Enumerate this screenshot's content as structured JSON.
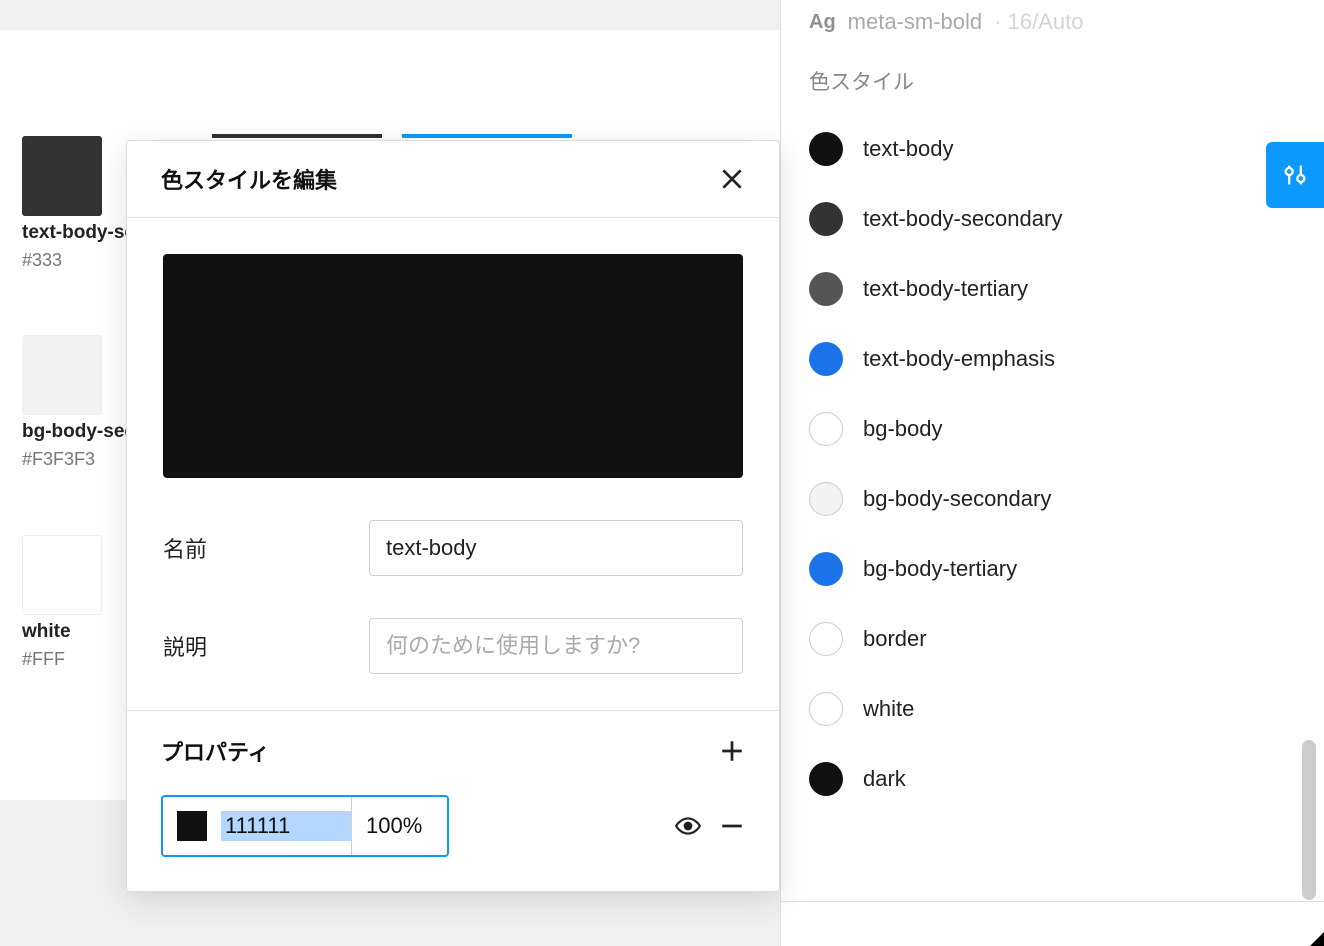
{
  "canvas": {
    "swatches": [
      {
        "label": "text-body-sec",
        "hex": "#333"
      },
      {
        "label": "bg-body-seco",
        "hex": "#F3F3F3"
      },
      {
        "label": "white",
        "hex": "#FFF"
      }
    ]
  },
  "modal": {
    "title": "色スタイルを編集",
    "name_label": "名前",
    "name_value": "text-body",
    "desc_label": "説明",
    "desc_placeholder": "何のために使用しますか?",
    "props_title": "プロパティ",
    "hex_value": "111111",
    "opacity_value": "100%",
    "preview_color": "#111111"
  },
  "right_panel": {
    "text_style": {
      "ag": "Ag",
      "name": "meta-sm-bold",
      "meta": "· 16/Auto"
    },
    "section_title": "色スタイル",
    "styles": [
      {
        "name": "text-body",
        "color": "#111111",
        "outlined": false
      },
      {
        "name": "text-body-secondary",
        "color": "#333333",
        "outlined": false
      },
      {
        "name": "text-body-tertiary",
        "color": "#555555",
        "outlined": false
      },
      {
        "name": "text-body-emphasis",
        "color": "#1a73e8",
        "outlined": false
      },
      {
        "name": "bg-body",
        "color": "#ffffff",
        "outlined": true
      },
      {
        "name": "bg-body-secondary",
        "color": "#f3f3f3",
        "outlined": true
      },
      {
        "name": "bg-body-tertiary",
        "color": "#1a73e8",
        "outlined": false
      },
      {
        "name": "border",
        "color": "#ffffff",
        "outlined": true
      },
      {
        "name": "white",
        "color": "#ffffff",
        "outlined": true
      },
      {
        "name": "dark",
        "color": "#111111",
        "outlined": false
      }
    ]
  }
}
